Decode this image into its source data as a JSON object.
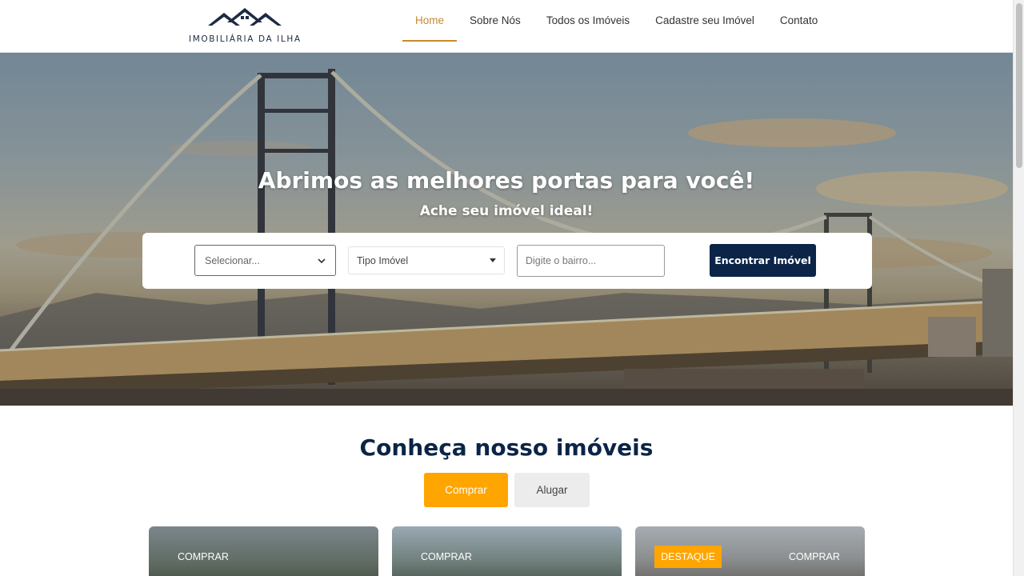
{
  "logo": {
    "text": "IMOBILIÁRIA DA ILHA"
  },
  "nav": {
    "items": [
      {
        "label": "Home",
        "active": true
      },
      {
        "label": "Sobre Nós"
      },
      {
        "label": "Todos os Imóveis"
      },
      {
        "label": "Cadastre seu Imóvel"
      },
      {
        "label": "Contato"
      }
    ]
  },
  "hero": {
    "title": "Abrimos as melhores portas para você!",
    "subtitle": "Ache seu imóvel ideal!"
  },
  "search": {
    "select_value": "Selecionar...",
    "type_value": "Tipo Imóvel",
    "neighborhood_placeholder": "Digite o bairro...",
    "button_label": "Encontrar Imóvel"
  },
  "section": {
    "title": "Conheça nosso imóveis",
    "tabs": [
      {
        "label": "Comprar",
        "active": true
      },
      {
        "label": "Alugar"
      }
    ]
  },
  "cards": [
    {
      "label": "COMPRAR"
    },
    {
      "label": "COMPRAR"
    },
    {
      "label": "COMPRAR",
      "badge": "DESTAQUE"
    }
  ],
  "colors": {
    "brand_navy": "#0b2447",
    "accent_orange": "#ffa500",
    "nav_active": "#c98a2c"
  }
}
